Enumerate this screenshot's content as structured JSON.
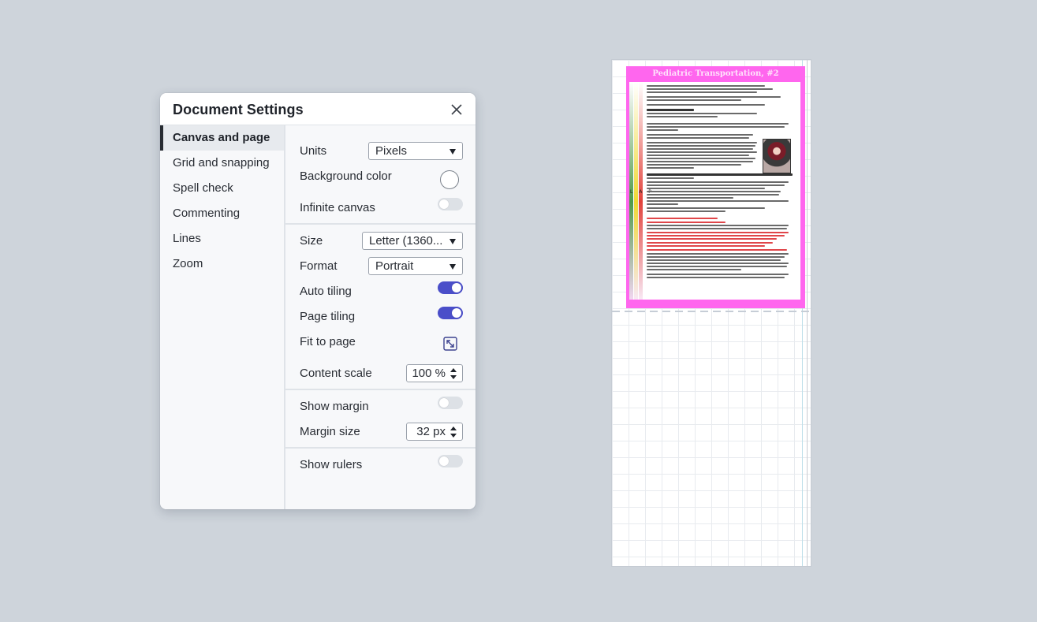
{
  "dialog": {
    "title": "Document Settings",
    "close_icon": "close-icon"
  },
  "sidebar": {
    "items": [
      {
        "label": "Canvas and page",
        "active": true
      },
      {
        "label": "Grid and snapping",
        "active": false
      },
      {
        "label": "Spell check",
        "active": false
      },
      {
        "label": "Commenting",
        "active": false
      },
      {
        "label": "Lines",
        "active": false
      },
      {
        "label": "Zoom",
        "active": false
      }
    ]
  },
  "settings": {
    "units": {
      "label": "Units",
      "value": "Pixels"
    },
    "background_color": {
      "label": "Background color",
      "value": "#ffffff"
    },
    "infinite_canvas": {
      "label": "Infinite canvas",
      "on": false
    },
    "size": {
      "label": "Size",
      "value": "Letter (1360..."
    },
    "format": {
      "label": "Format",
      "value": "Portrait"
    },
    "auto_tiling": {
      "label": "Auto tiling",
      "on": true
    },
    "page_tiling": {
      "label": "Page tiling",
      "on": true
    },
    "fit_to_page": {
      "label": "Fit to page",
      "icon": "fit-to-page-icon"
    },
    "content_scale": {
      "label": "Content scale",
      "value": "100 %"
    },
    "show_margin": {
      "label": "Show margin",
      "on": false
    },
    "margin_size": {
      "label": "Margin size",
      "value": "32 px"
    },
    "show_rulers": {
      "label": "Show rulers",
      "on": false
    }
  },
  "colors": {
    "accent": "#4a4ec9",
    "flyer_border": "#ff66ee",
    "background": "#ced4db"
  },
  "canvas": {
    "flyer": {
      "title": "Pediatric Transportation, #2",
      "side_label": "L A P"
    }
  }
}
